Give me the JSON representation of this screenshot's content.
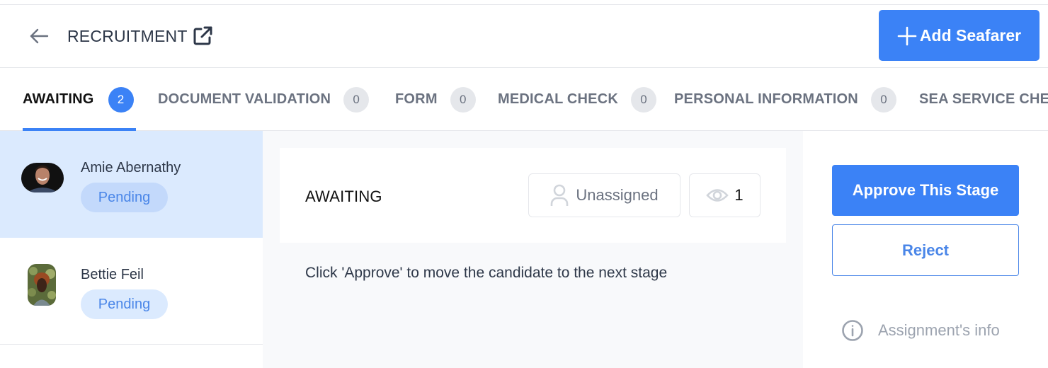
{
  "header": {
    "title": "RECRUITMENT",
    "back_icon": "arrow-left-icon",
    "external_icon": "external-link-icon",
    "add_button_label": "Add Seafarer",
    "add_icon": "plus-icon"
  },
  "tabs": [
    {
      "label": "AWAITING",
      "count": "2",
      "active": true
    },
    {
      "label": "DOCUMENT VALIDATION",
      "count": "0",
      "active": false
    },
    {
      "label": "FORM",
      "count": "0",
      "active": false
    },
    {
      "label": "MEDICAL CHECK",
      "count": "0",
      "active": false
    },
    {
      "label": "PERSONAL INFORMATION",
      "count": "0",
      "active": false
    },
    {
      "label": "SEA SERVICE CHE",
      "count": "",
      "active": false
    }
  ],
  "candidates": [
    {
      "name": "Amie Abernathy",
      "status": "Pending",
      "selected": true
    },
    {
      "name": "Bettie Feil",
      "status": "Pending",
      "selected": false
    }
  ],
  "stage": {
    "title": "AWAITING",
    "assignee_label": "Unassigned",
    "assignee_icon": "user-icon",
    "views_icon": "eye-icon",
    "views_count": "1",
    "instruction": "Click 'Approve' to move the candidate to the next stage"
  },
  "actions": {
    "approve_label": "Approve This Stage",
    "reject_label": "Reject",
    "info_label": "Assignment's info",
    "info_icon": "info-icon"
  },
  "colors": {
    "accent": "#3b82f6",
    "selected_row": "#dbeafe",
    "pending_text": "#4a86e8",
    "muted": "#6b7280"
  }
}
